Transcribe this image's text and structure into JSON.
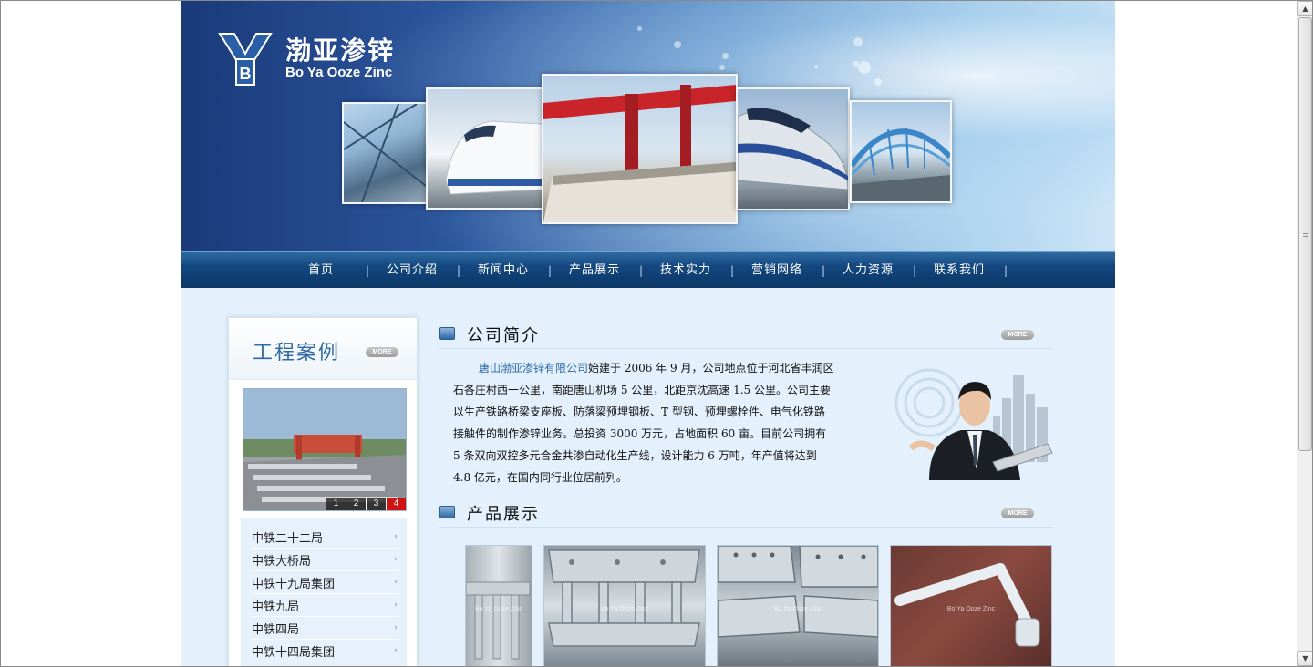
{
  "logo": {
    "name_cn": "渤亚渗锌",
    "name_en": "Bo Ya Ooze Zinc"
  },
  "nav": {
    "items": [
      "首页",
      "公司介绍",
      "新闻中心",
      "产品展示",
      "技术实力",
      "营销网络",
      "人力资源",
      "联系我们"
    ]
  },
  "more_label": "MORE",
  "cases": {
    "title": "工程案例",
    "pager": [
      "1",
      "2",
      "3",
      "4"
    ],
    "active_page": "4",
    "items": [
      "中铁二十二局",
      "中铁大桥局",
      "中铁十九局集团",
      "中铁九局",
      "中铁四局",
      "中铁十四局集团"
    ]
  },
  "about": {
    "title": "公司简介",
    "company_name": "唐山渤亚渗锌有限公司",
    "text": "始建于 2006 年 9 月，公司地点位于河北省丰润区石各庄村西一公里，南距唐山机场 5 公里，北距京沈高速 1.5 公里。公司主要以生产铁路桥梁支座板、防落梁预埋钢板、T 型钢、预埋螺栓件、电气化铁路接触件的制作渗锌业务。总投资 3000 万元，占地面积 60 亩。目前公司拥有 5 条双向双控多元合金共渗自动化生产线，设计能力 6 万吨，年产值将达到 4.8 亿元，在国内同行业位居前列。"
  },
  "products": {
    "title": "产品展示",
    "watermark": "Bo Ya Ooze Zinc"
  },
  "colors": {
    "nav_bg": "#13477e",
    "accent": "#2f6aa6",
    "pager_active": "#cc1414",
    "page_bg": "#e4f0fb"
  }
}
